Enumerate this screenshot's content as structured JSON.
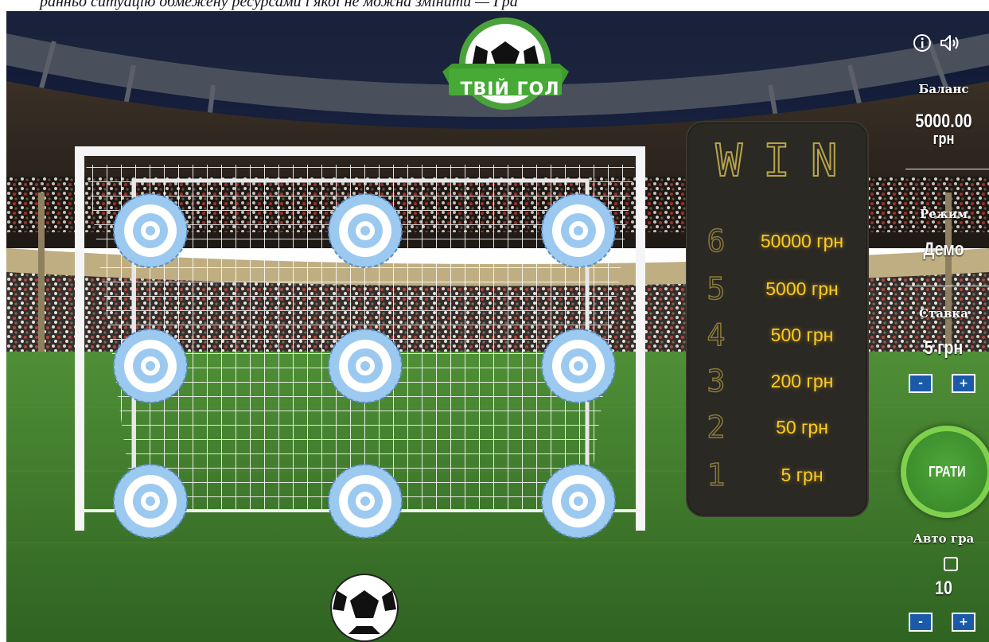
{
  "caption": "ранньо ситуацію обмежену ресурсами і якої не можна змінити — Гра",
  "game": {
    "logo_text": "ТВІЙ ГОЛ"
  },
  "scoreboard": {
    "title": "WIN",
    "prizes": [
      {
        "num": "6",
        "value": "50000 грн"
      },
      {
        "num": "5",
        "value": "5000 грн"
      },
      {
        "num": "4",
        "value": "500 грн"
      },
      {
        "num": "3",
        "value": "200 грн"
      },
      {
        "num": "2",
        "value": "50 грн"
      },
      {
        "num": "1",
        "value": "5 грн"
      }
    ]
  },
  "panel": {
    "info_icon": "info-icon",
    "sound_icon": "speaker-icon",
    "balance_label": "Баланс",
    "balance_value": "5000.00",
    "balance_currency": "грн",
    "mode_label": "Режим",
    "mode_value": "Демо",
    "bet_label": "Ставка",
    "bet_value": "5 грн",
    "minus": "-",
    "plus": "+",
    "play_label": "ГРАТИ",
    "auto_label": "Авто гра",
    "auto_checked": false,
    "auto_count": "10"
  },
  "targets_count": 9,
  "colors": {
    "pitch": "#3f7a2c",
    "target_blue": "#9cc9f0",
    "scoreboard": "#2b2924",
    "prize_text": "#ffcc1f",
    "play_button": "#3c8e2c",
    "step_button": "#1a5aa8"
  }
}
